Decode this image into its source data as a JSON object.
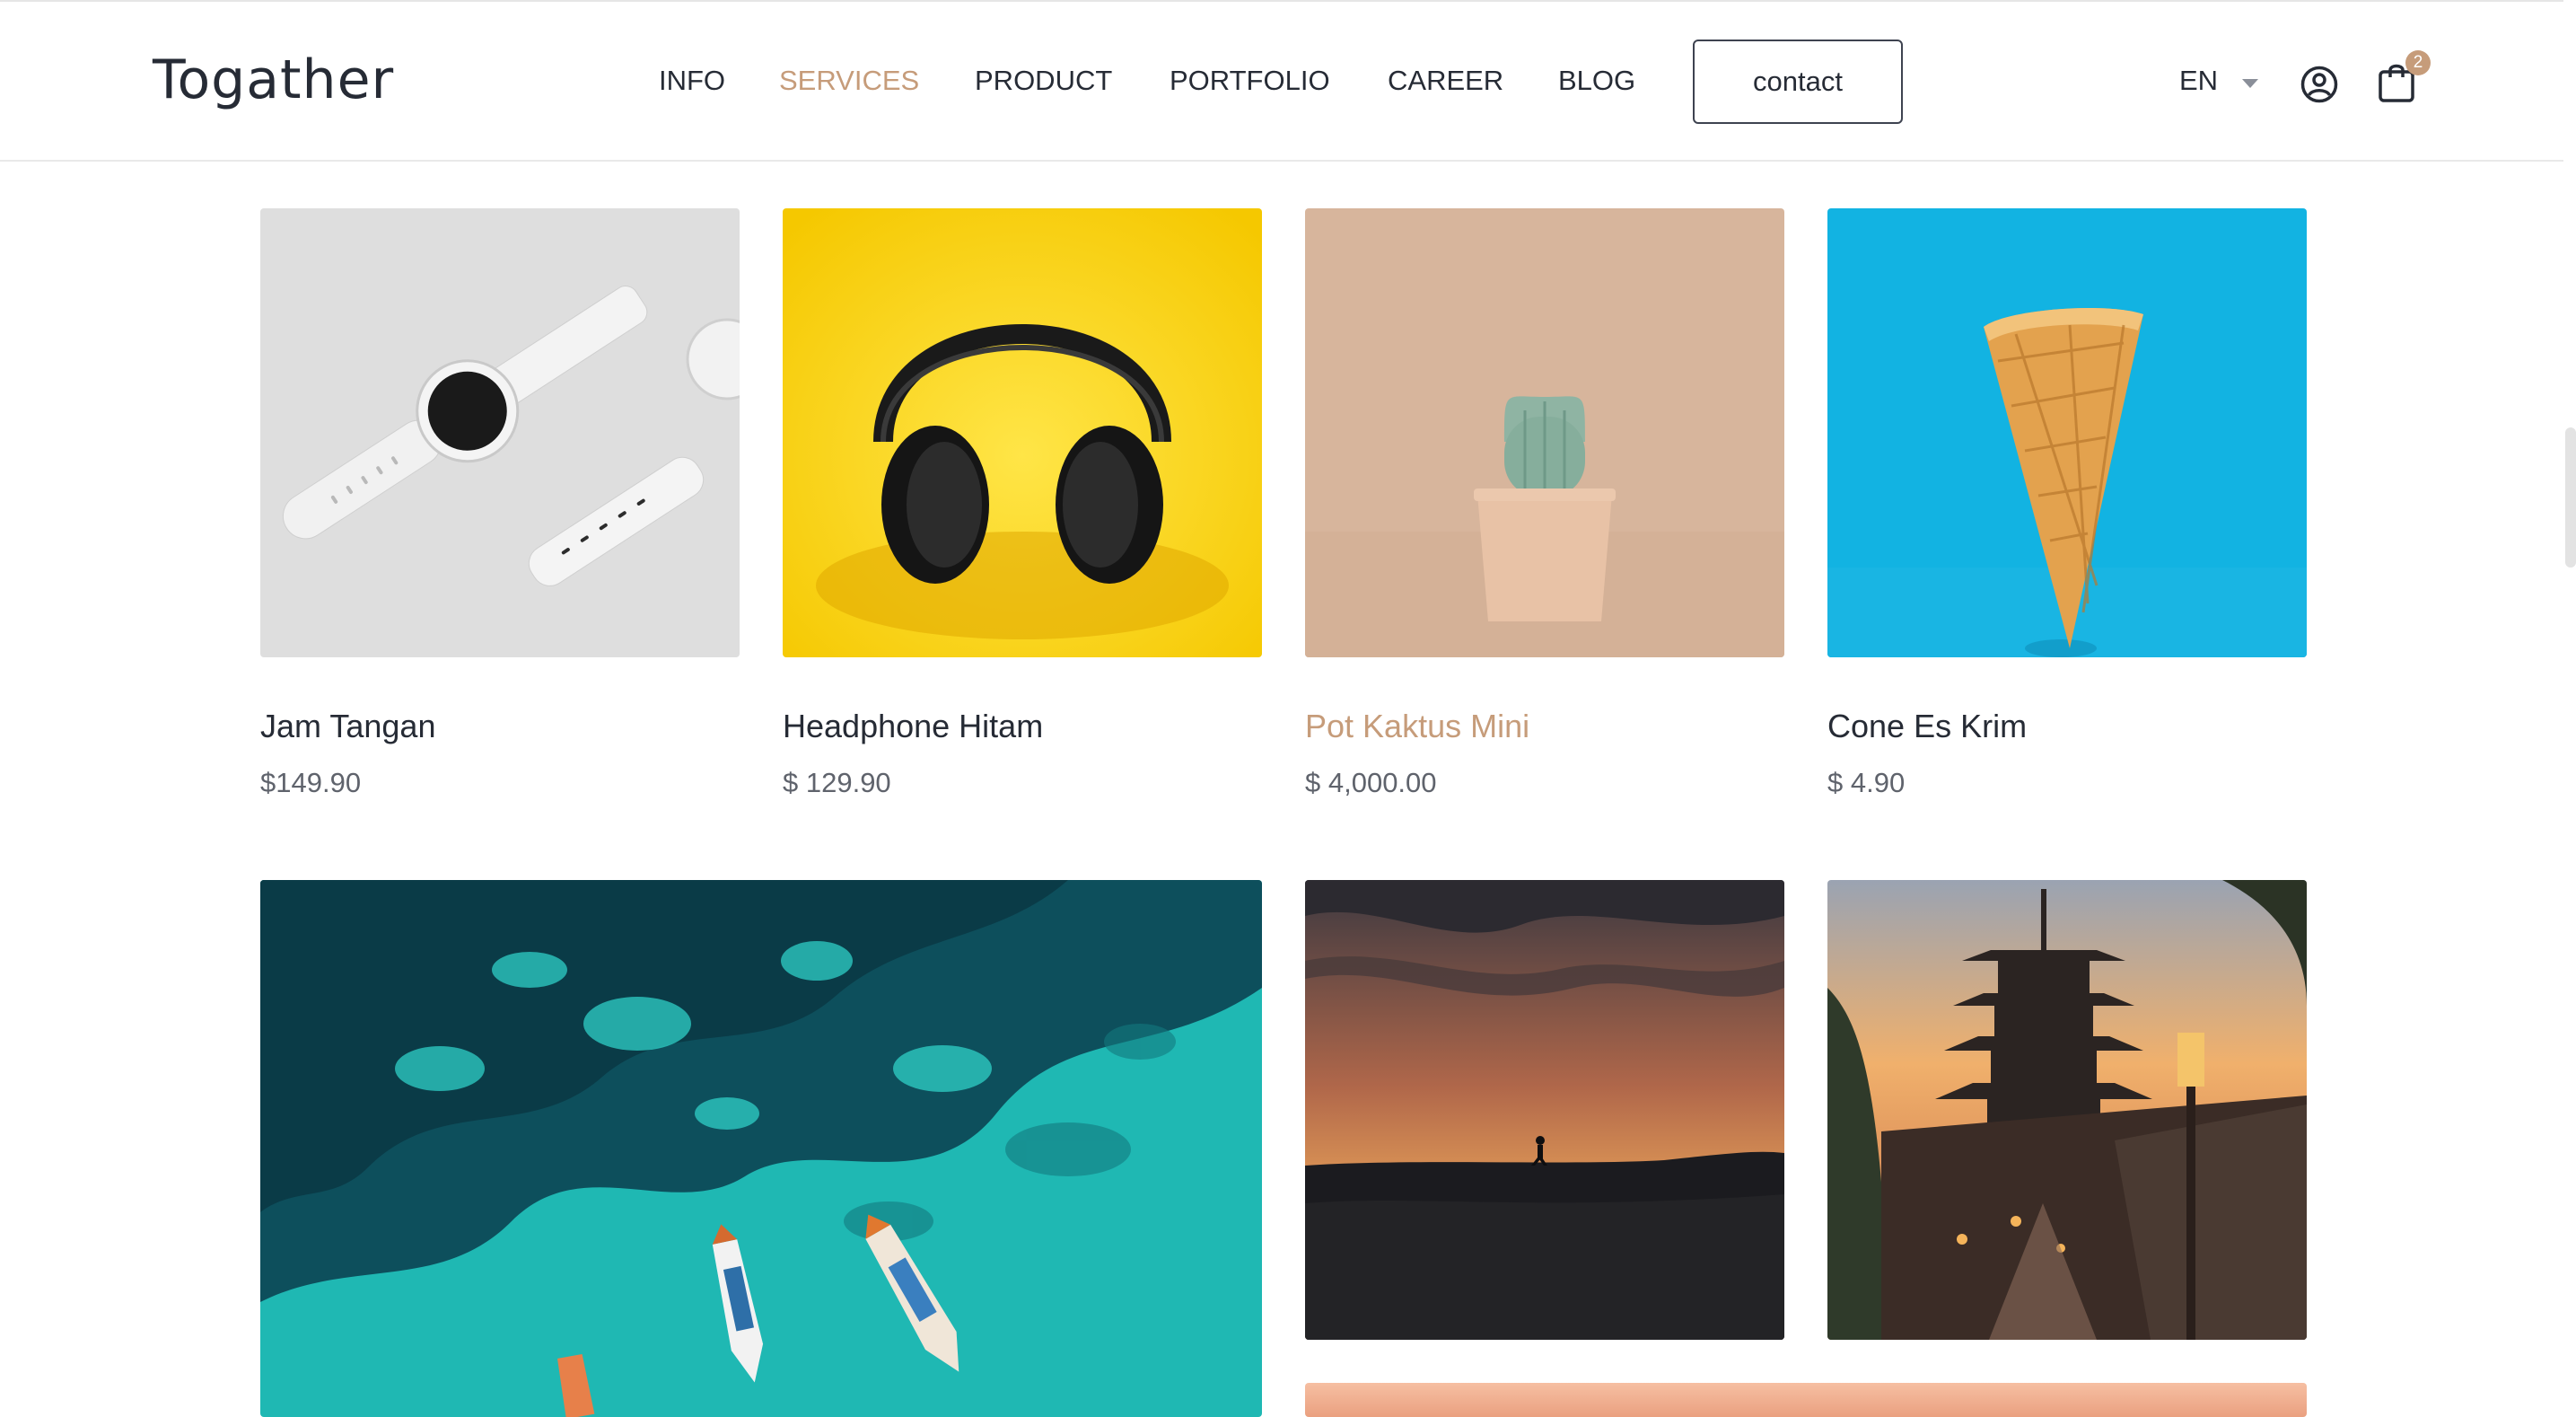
{
  "brand": {
    "logo": "Togather"
  },
  "nav": {
    "items": [
      {
        "label": "INFO",
        "active": false
      },
      {
        "label": "SERVICES",
        "active": true
      },
      {
        "label": "PRODUCT",
        "active": false
      },
      {
        "label": "PORTFOLIO",
        "active": false
      },
      {
        "label": "CAREER",
        "active": false
      },
      {
        "label": "BLOG",
        "active": false
      }
    ],
    "contact_label": "contact"
  },
  "header_right": {
    "language": "EN",
    "cart_count": "2",
    "icons": [
      "chevron-down-icon",
      "user-icon",
      "shopping-bag-icon"
    ]
  },
  "products": [
    {
      "name": "Jam Tangan",
      "price": "$149.90",
      "image": "white-smartwatch-image",
      "highlighted": false
    },
    {
      "name": "Headphone Hitam",
      "price": "$ 129.90",
      "image": "black-headphones-image",
      "highlighted": false
    },
    {
      "name": "Pot Kaktus Mini",
      "price": "$ 4,000.00",
      "image": "mini-cactus-pot-image",
      "highlighted": true
    },
    {
      "name": "Cone Es Krim",
      "price": "$ 4.90",
      "image": "ice-cream-cone-image",
      "highlighted": false
    }
  ],
  "gallery": [
    {
      "image": "turquoise-sea-boats-image"
    },
    {
      "image": "sunset-hiker-silhouette-image"
    },
    {
      "image": "japanese-pagoda-street-image"
    },
    {
      "image": "peach-banner-image"
    }
  ],
  "colors": {
    "accent": "#c69c7a",
    "text": "#262b35",
    "muted": "#5f636c"
  }
}
